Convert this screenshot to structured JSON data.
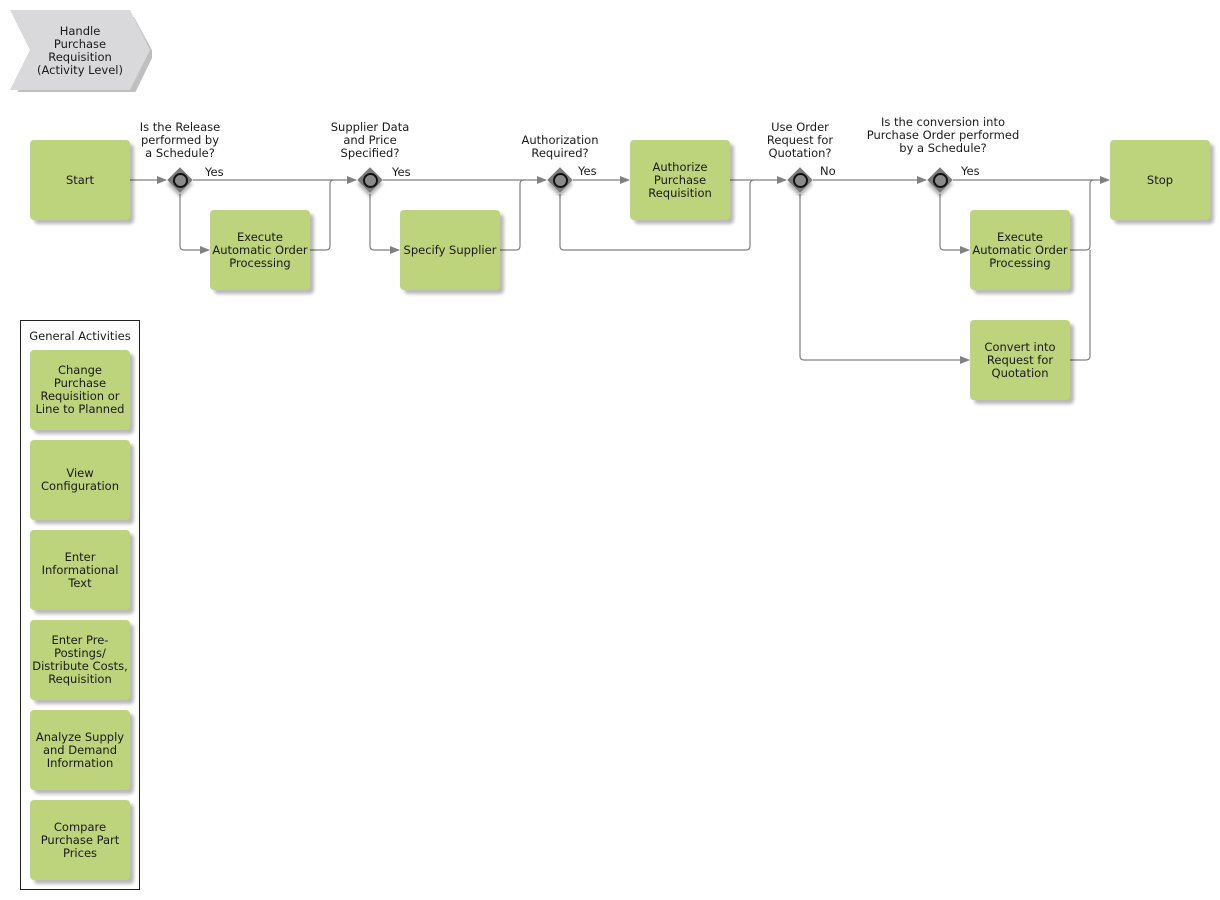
{
  "title": "Handle\nPurchase\nRequisition\n(Activity Level)",
  "colors": {
    "task_fill": "#bdd37c",
    "gateway_fill": "#7a7a7a",
    "title_fill": "#d9d9dc",
    "connector": "#808080"
  },
  "nodes": {
    "start": "Start",
    "stop": "Stop",
    "exec_auto_1": "Execute\nAutomatic Order\nProcessing",
    "specify_supplier": "Specify Supplier",
    "authorize": "Authorize\nPurchase\nRequisition",
    "exec_auto_2": "Execute\nAutomatic Order\nProcessing",
    "convert_rfq": "Convert into\nRequest for\nQuotation"
  },
  "gateways": [
    {
      "question": "Is the Release\nperformed by\na Schedule?",
      "flow_label": "Yes"
    },
    {
      "question": "Supplier Data\nand Price\nSpecified?",
      "flow_label": "Yes"
    },
    {
      "question": "Authorization\nRequired?",
      "flow_label": "Yes"
    },
    {
      "question": "Use Order\nRequest for\nQuotation?",
      "flow_label": "No"
    },
    {
      "question": "Is the conversion into\nPurchase Order performed\nby a Schedule?",
      "flow_label": "Yes"
    }
  ],
  "general_activities": {
    "title": "General Activities",
    "items": [
      "Change\nPurchase\nRequisition or\nLine to Planned",
      "View\nConfiguration",
      "Enter\nInformational\nText",
      "Enter Pre-\nPostings/\nDistribute Costs,\nRequisition",
      "Analyze Supply\nand Demand\nInformation",
      "Compare\nPurchase Part\nPrices"
    ]
  }
}
